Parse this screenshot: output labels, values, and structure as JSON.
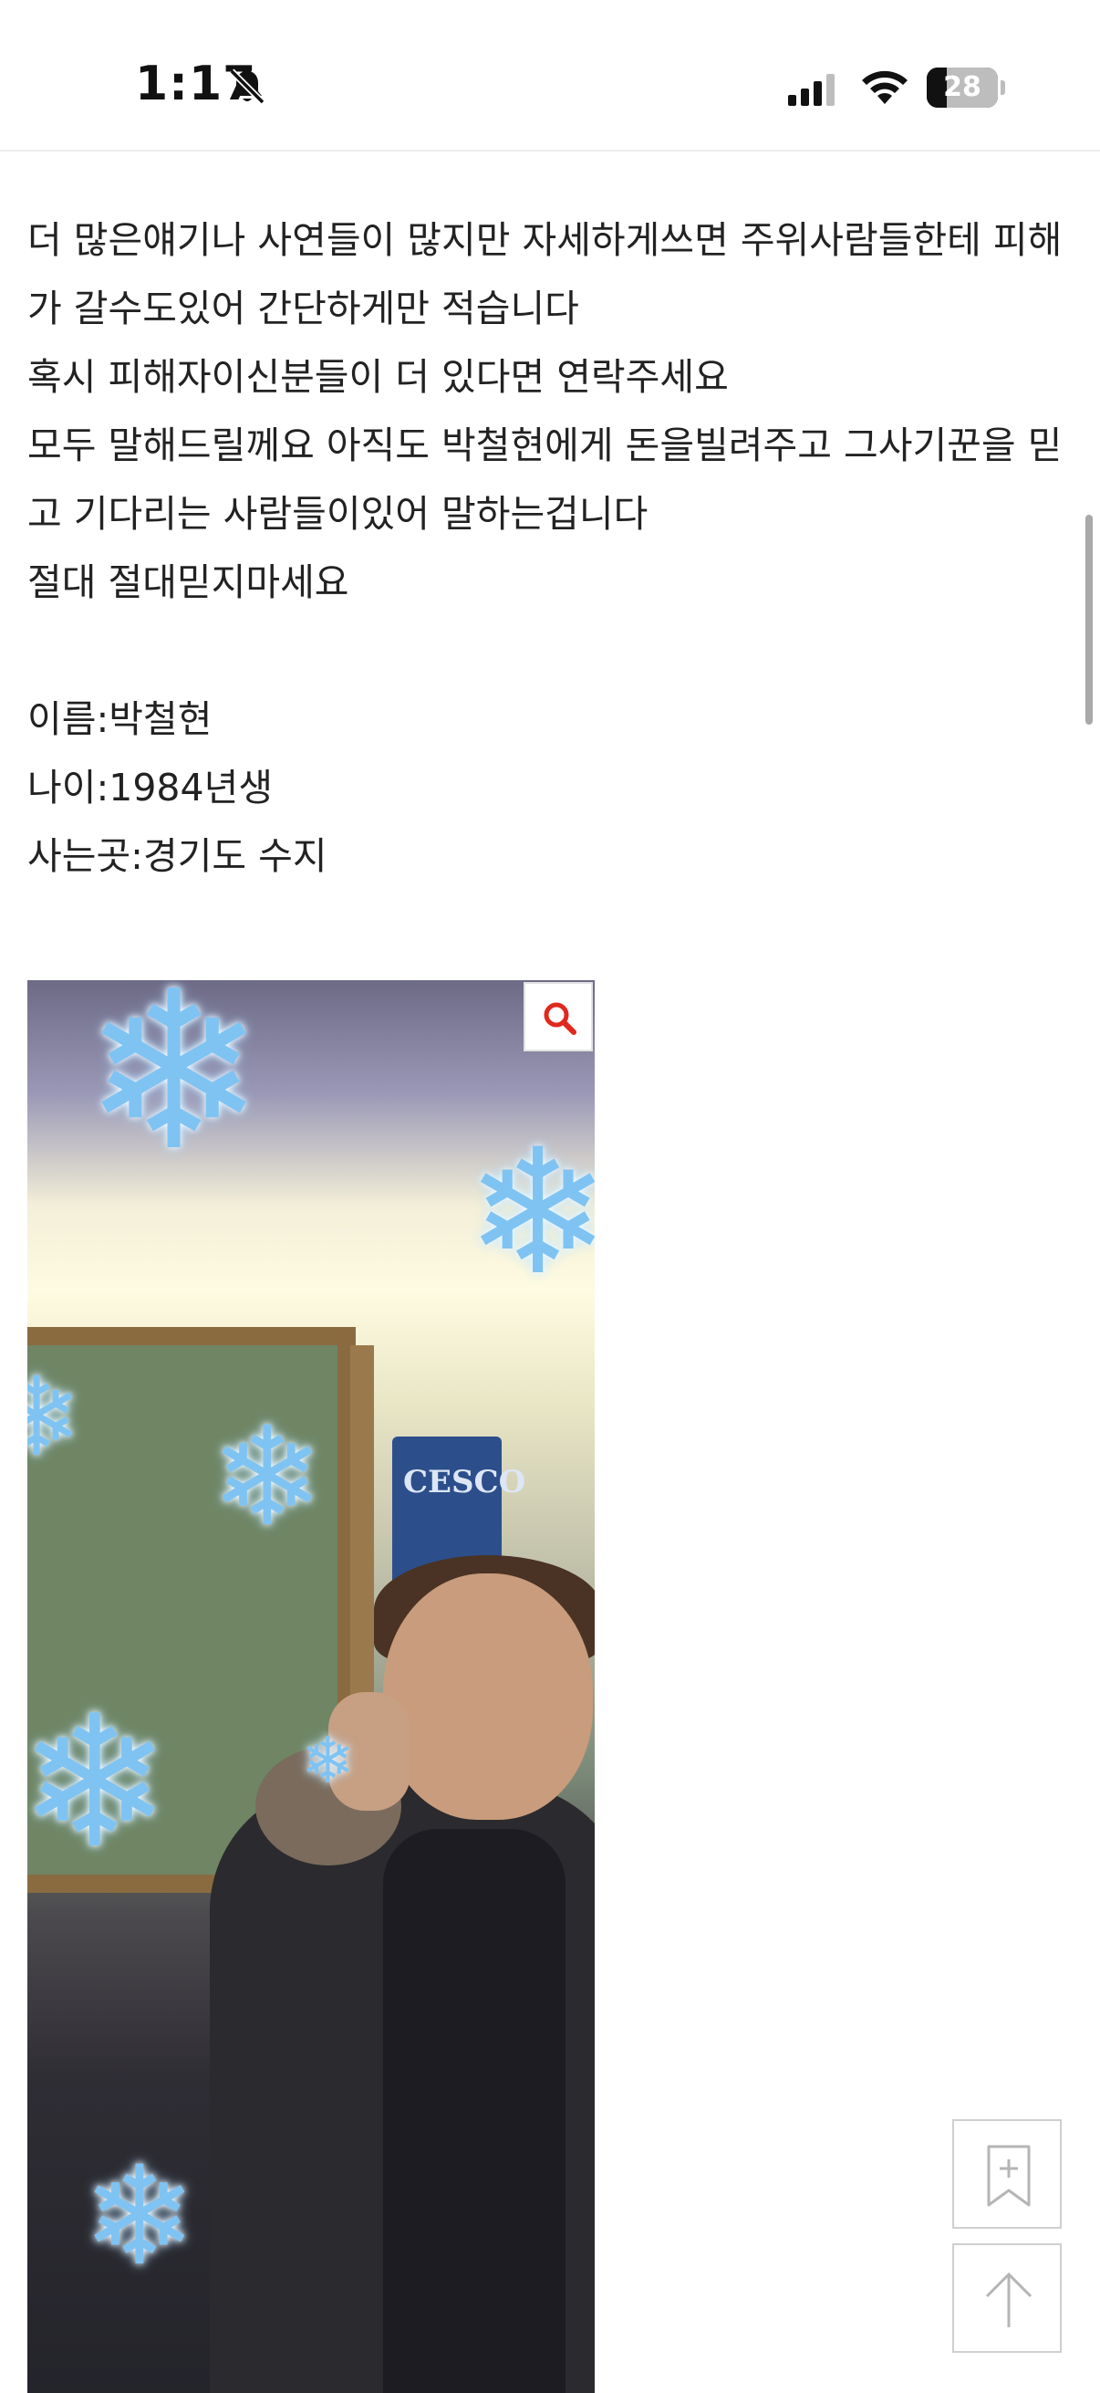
{
  "status_bar": {
    "time": "1:17",
    "battery_level": "28",
    "battery_fraction": 0.28,
    "icons": [
      "bell-slash-icon",
      "cellular-signal-icon",
      "wifi-icon",
      "battery-icon"
    ]
  },
  "article": {
    "lines": [
      "더 많은얘기나 사연들이 많지만 자세하게쓰면 주위사람들한테 피해",
      "가 갈수도있어 간단하게만 적습니다",
      "혹시 피해자이신분들이 더 있다면 연락주세요",
      "모두 말해드릴께요 아직도 박철현에게 돈을빌려주고 그사기꾼을 믿",
      "고 기다리는 사람들이있어 말하는겁니다",
      "절대 절대믿지마세요",
      "",
      "이름:박철현",
      "나이:1984년생",
      "사는곳:경기도 수지"
    ]
  },
  "photo": {
    "sign_text": "CESCO",
    "zoom_icon": "magnifier-icon"
  },
  "floating_buttons": {
    "bookmark_icon": "bookmark-add-icon",
    "scroll_top_icon": "arrow-up-icon"
  },
  "colors": {
    "zoom_icon": "#e0281e",
    "text": "#222222",
    "button_border": "#cfcfcf"
  }
}
